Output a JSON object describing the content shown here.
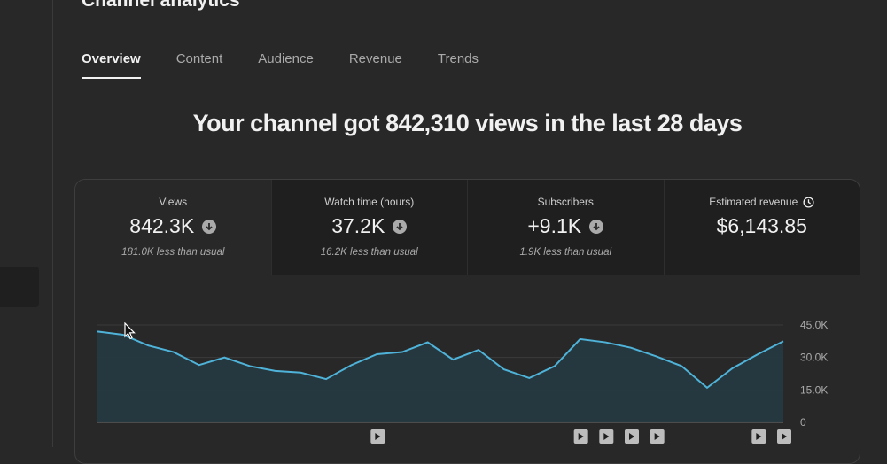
{
  "header": {
    "title": "Channel analytics"
  },
  "tabs": [
    {
      "label": "Overview",
      "active": true
    },
    {
      "label": "Content",
      "active": false
    },
    {
      "label": "Audience",
      "active": false
    },
    {
      "label": "Revenue",
      "active": false
    },
    {
      "label": "Trends",
      "active": false
    }
  ],
  "headline": "Your channel got 842,310 views in the last 28 days",
  "metrics": [
    {
      "label": "Views",
      "value": "842.3K",
      "sub": "181.0K less than usual",
      "icon": "arrow-down-icon"
    },
    {
      "label": "Watch time (hours)",
      "value": "37.2K",
      "sub": "16.2K less than usual",
      "icon": "arrow-down-icon"
    },
    {
      "label": "Subscribers",
      "value": "+9.1K",
      "sub": "1.9K less than usual",
      "icon": "arrow-down-icon"
    },
    {
      "label": "Estimated revenue",
      "value": "$6,143.85",
      "sub": "",
      "icon": "clock-icon"
    }
  ],
  "colors": {
    "line": "#4fb3d9",
    "fill": "#263940",
    "accent": "#f1f1f1"
  },
  "chart_data": {
    "type": "line",
    "x": [
      1,
      2,
      3,
      4,
      5,
      6,
      7,
      8,
      9,
      10,
      11,
      12,
      13,
      14,
      15,
      16,
      17,
      18,
      19,
      20,
      21,
      22,
      23,
      24,
      25,
      26,
      27,
      28
    ],
    "values": [
      42000,
      40500,
      35500,
      32500,
      26500,
      30000,
      26000,
      23800,
      23000,
      20000,
      26500,
      31500,
      32500,
      37000,
      29000,
      33500,
      24500,
      20500,
      26000,
      38500,
      37000,
      34500,
      30500,
      26000,
      16000,
      25000,
      31500,
      37500
    ],
    "ylim": [
      0,
      45000
    ],
    "yticks": [
      "0",
      "15.0K",
      "30.0K",
      "45.0K"
    ],
    "grid": true,
    "video_markers": [
      12,
      20,
      21,
      22,
      23,
      27,
      28
    ]
  }
}
